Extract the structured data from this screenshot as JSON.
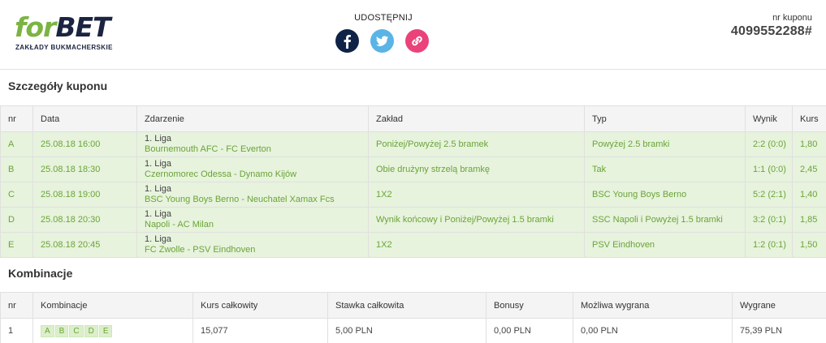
{
  "brand": {
    "logo_for": "for",
    "logo_bet": "BET",
    "logo_sub": "ZAKŁADY BUKMACHERSKIE"
  },
  "share": {
    "label": "UDOSTĘPNIJ",
    "icons": [
      "facebook-icon",
      "twitter-icon",
      "link-icon"
    ]
  },
  "coupon": {
    "label": "nr kuponu",
    "number": "4099552288#"
  },
  "details": {
    "title": "Szczegóły kuponu",
    "headers": {
      "nr": "nr",
      "date": "Data",
      "event": "Zdarzenie",
      "bet": "Zakład",
      "type": "Typ",
      "result": "Wynik",
      "odds": "Kurs"
    },
    "rows": [
      {
        "nr": "A",
        "date": "25.08.18 16:00",
        "league": "1. Liga",
        "match": "Bournemouth AFC - FC Everton",
        "bet": "Poniżej/Powyżej 2.5 bramek",
        "type": "Powyżej 2.5 bramki",
        "result": "2:2 (0:0)",
        "odds": "1,80"
      },
      {
        "nr": "B",
        "date": "25.08.18 18:30",
        "league": "1. Liga",
        "match": "Czernomorec Odessa - Dynamo Kijów",
        "bet": "Obie drużyny strzelą bramkę",
        "type": "Tak",
        "result": "1:1 (0:0)",
        "odds": "2,45"
      },
      {
        "nr": "C",
        "date": "25.08.18 19:00",
        "league": "1. Liga",
        "match": "BSC Young Boys Berno - Neuchatel Xamax Fcs",
        "bet": "1X2",
        "type": "BSC Young Boys Berno",
        "result": "5:2 (2:1)",
        "odds": "1,40"
      },
      {
        "nr": "D",
        "date": "25.08.18 20:30",
        "league": "1. Liga",
        "match": "Napoli - AC Milan",
        "bet": "Wynik końcowy i Poniżej/Powyżej 1.5 bramki",
        "type": "SSC Napoli i Powyżej 1.5 bramki",
        "result": "3:2 (0:1)",
        "odds": "1,85"
      },
      {
        "nr": "E",
        "date": "25.08.18 20:45",
        "league": "1. Liga",
        "match": "FC Zwolle - PSV Eindhoven",
        "bet": "1X2",
        "type": "PSV Eindhoven",
        "result": "1:2 (0:1)",
        "odds": "1,50"
      }
    ]
  },
  "combinations": {
    "title": "Kombinacje",
    "headers": {
      "nr": "nr",
      "combo": "Kombinacje",
      "total_odds": "Kurs całkowity",
      "total_stake": "Stawka całkowita",
      "bonus": "Bonusy",
      "possible_win": "Możliwa wygrana",
      "won": "Wygrane"
    },
    "rows": [
      {
        "nr": "1",
        "letters": [
          "A",
          "B",
          "C",
          "D",
          "E"
        ],
        "total_odds": "15,077",
        "total_stake": "5,00 PLN",
        "bonus": "0,00 PLN",
        "possible_win": "0,00 PLN",
        "won": "75,39 PLN"
      }
    ]
  }
}
